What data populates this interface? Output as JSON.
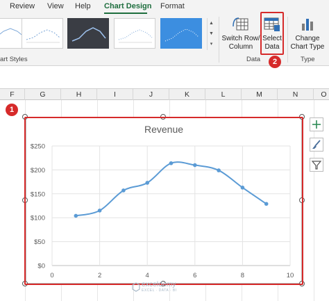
{
  "ribbon": {
    "tabs": [
      "Review",
      "View",
      "Help",
      "Chart Design",
      "Format"
    ],
    "active_tab": "Chart Design",
    "groups": {
      "chart_styles": "art Styles",
      "data": "Data",
      "type": "Type"
    },
    "buttons": {
      "switch_row_column_line1": "Switch Row/",
      "switch_row_column_line2": "Column",
      "select_data_line1": "Select",
      "select_data_line2": "Data",
      "change_chart_type_line1": "Change",
      "change_chart_type_line2": "Chart Type"
    }
  },
  "steps": {
    "step1": "1",
    "step2": "2"
  },
  "sheet": {
    "columns": [
      "F",
      "G",
      "H",
      "I",
      "J",
      "K",
      "L",
      "M",
      "N",
      "O"
    ]
  },
  "chart_data": {
    "type": "scatter",
    "title": "Revenue",
    "xlim": [
      0,
      10
    ],
    "ylim": [
      0,
      250
    ],
    "x_ticks": [
      "0",
      "2",
      "4",
      "6",
      "8",
      "10"
    ],
    "y_ticks": [
      "$0",
      "$50",
      "$100",
      "$150",
      "$200",
      "$250"
    ],
    "x": [
      1,
      2,
      3,
      4,
      5,
      6,
      7,
      8,
      9
    ],
    "y": [
      104,
      115,
      157,
      173,
      214,
      210,
      199,
      163,
      129
    ],
    "line_style": "smooth",
    "grid": true,
    "color": "#5b9bd5"
  },
  "side_tools": [
    "plus-icon",
    "brush-icon",
    "filter-icon"
  ],
  "watermark": {
    "name": "exceldemy",
    "tagline": "EXCEL · DATA · BI"
  }
}
